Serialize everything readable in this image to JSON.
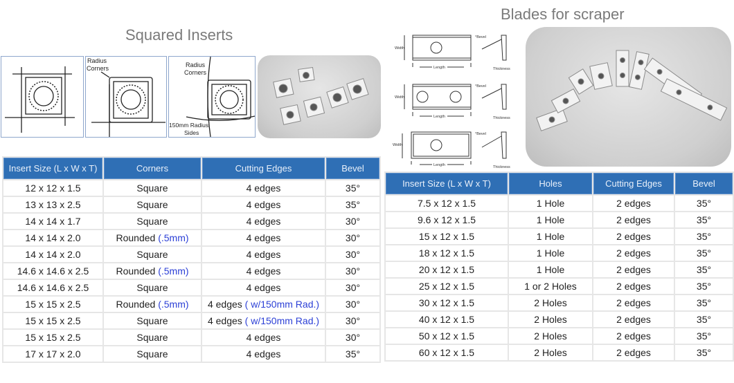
{
  "left_section": {
    "title": "Squared Inserts",
    "diagrams": [
      {
        "name": "square-corners",
        "labels": []
      },
      {
        "name": "radius-corners",
        "labels": [
          "Radius",
          "Corners"
        ]
      },
      {
        "name": "radius-corners-sides",
        "labels": [
          "Radius",
          "Corners",
          "150mm Radius",
          "Sides"
        ]
      }
    ],
    "table": {
      "headers": [
        "Insert Size (L x W x T)",
        "Corners",
        "Cutting Edges",
        "Bevel"
      ],
      "rows": [
        {
          "size": "12 x 12 x 1.5",
          "corners": "Square",
          "corners_note": "",
          "edges": "4 edges",
          "edges_note": "",
          "bevel": "35°"
        },
        {
          "size": "13 x 13 x 2.5",
          "corners": "Square",
          "corners_note": "",
          "edges": "4 edges",
          "edges_note": "",
          "bevel": "35°"
        },
        {
          "size": "14 x 14 x 1.7",
          "corners": "Square",
          "corners_note": "",
          "edges": "4 edges",
          "edges_note": "",
          "bevel": "30°"
        },
        {
          "size": "14 x 14 x 2.0",
          "corners": "Rounded",
          "corners_note": "(.5mm)",
          "edges": "4 edges",
          "edges_note": "",
          "bevel": "30°"
        },
        {
          "size": "14 x 14 x 2.0",
          "corners": "Square",
          "corners_note": "",
          "edges": "4 edges",
          "edges_note": "",
          "bevel": "30°"
        },
        {
          "size": "14.6 x 14.6 x 2.5",
          "corners": "Rounded",
          "corners_note": "(.5mm)",
          "edges": "4 edges",
          "edges_note": "",
          "bevel": "30°"
        },
        {
          "size": "14.6 x 14.6 x 2.5",
          "corners": "Square",
          "corners_note": "",
          "edges": "4 edges",
          "edges_note": "",
          "bevel": "30°"
        },
        {
          "size": "15 x 15 x 2.5",
          "corners": "Rounded",
          "corners_note": "(.5mm)",
          "edges": "4 edges",
          "edges_note": "( w/150mm Rad.)",
          "bevel": "30°"
        },
        {
          "size": "15 x 15 x 2.5",
          "corners": "Square",
          "corners_note": "",
          "edges": "4 edges",
          "edges_note": "( w/150mm Rad.)",
          "bevel": "30°"
        },
        {
          "size": "15 x 15 x 2.5",
          "corners": "Square",
          "corners_note": "",
          "edges": "4 edges",
          "edges_note": "",
          "bevel": "30°"
        },
        {
          "size": "17 x 17 x 2.0",
          "corners": "Square",
          "corners_note": "",
          "edges": "4 edges",
          "edges_note": "",
          "bevel": "35°"
        }
      ]
    }
  },
  "right_section": {
    "title": "Blades for scraper",
    "diagram_labels": {
      "width": "Width",
      "length": "Length",
      "bevel": "°Bevel",
      "thickness": "Thickness"
    },
    "table": {
      "headers": [
        "Insert Size (L x W x T)",
        "Holes",
        "Cutting Edges",
        "Bevel"
      ],
      "rows": [
        {
          "size": "7.5 x 12 x 1.5",
          "holes": "1 Hole",
          "edges": "2 edges",
          "bevel": "35°"
        },
        {
          "size": "9.6 x 12 x 1.5",
          "holes": "1 Hole",
          "edges": "2 edges",
          "bevel": "35°"
        },
        {
          "size": "15 x 12 x 1.5",
          "holes": "1 Hole",
          "edges": "2 edges",
          "bevel": "35°"
        },
        {
          "size": "18 x 12 x 1.5",
          "holes": "1 Hole",
          "edges": "2 edges",
          "bevel": "35°"
        },
        {
          "size": "20 x 12 x 1.5",
          "holes": "1 Hole",
          "edges": "2 edges",
          "bevel": "35°"
        },
        {
          "size": "25 x 12 x 1.5",
          "holes": "1 or 2 Holes",
          "edges": "2 edges",
          "bevel": "35°"
        },
        {
          "size": "30 x 12 x 1.5",
          "holes": "2 Holes",
          "edges": "2 edges",
          "bevel": "35°"
        },
        {
          "size": "40 x 12 x 1.5",
          "holes": "2 Holes",
          "edges": "2 edges",
          "bevel": "35°"
        },
        {
          "size": "50 x 12 x 1.5",
          "holes": "2 Holes",
          "edges": "2 edges",
          "bevel": "35°"
        },
        {
          "size": "60 x 12 x 1.5",
          "holes": "2 Holes",
          "edges": "2 edges",
          "bevel": "35°"
        }
      ]
    }
  },
  "colors": {
    "header_bg": "#2f6fb5",
    "note_blue": "#2b3fd6",
    "title_gray": "#7a7a7a"
  }
}
